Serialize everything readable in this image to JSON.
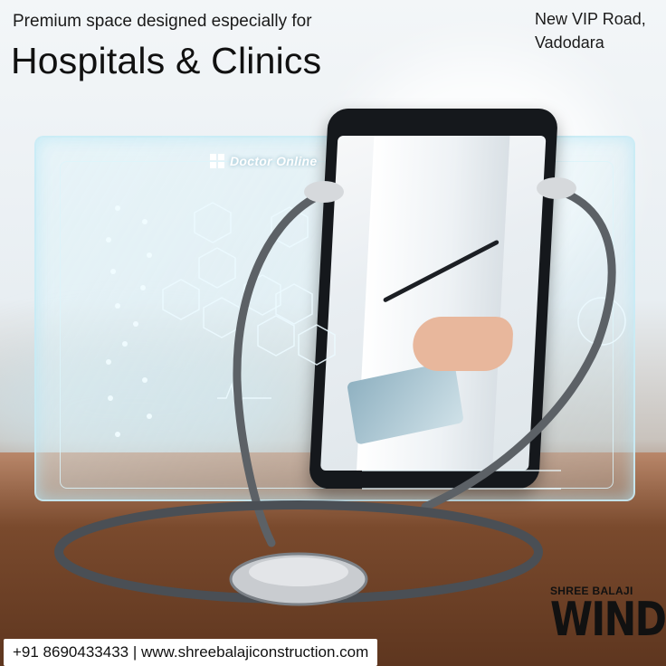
{
  "header": {
    "tagline": "Premium space designed especially for",
    "headline": "Hospitals & Clinics"
  },
  "location": {
    "line1": "New VIP Road,",
    "line2": "Vadodara"
  },
  "hologram": {
    "title": "Doctor Online",
    "icon": "windows-logo-icon"
  },
  "brand": {
    "prefix": "SHREE BALAJI",
    "name": "WIND"
  },
  "contact": {
    "text": "+91 8690433433 | www.shreebalajiconstruction.com"
  },
  "colors": {
    "text": "#111111",
    "hologram": "#cfeaf3",
    "desk": "#6d4127",
    "contact_bg": "#ffffff"
  }
}
